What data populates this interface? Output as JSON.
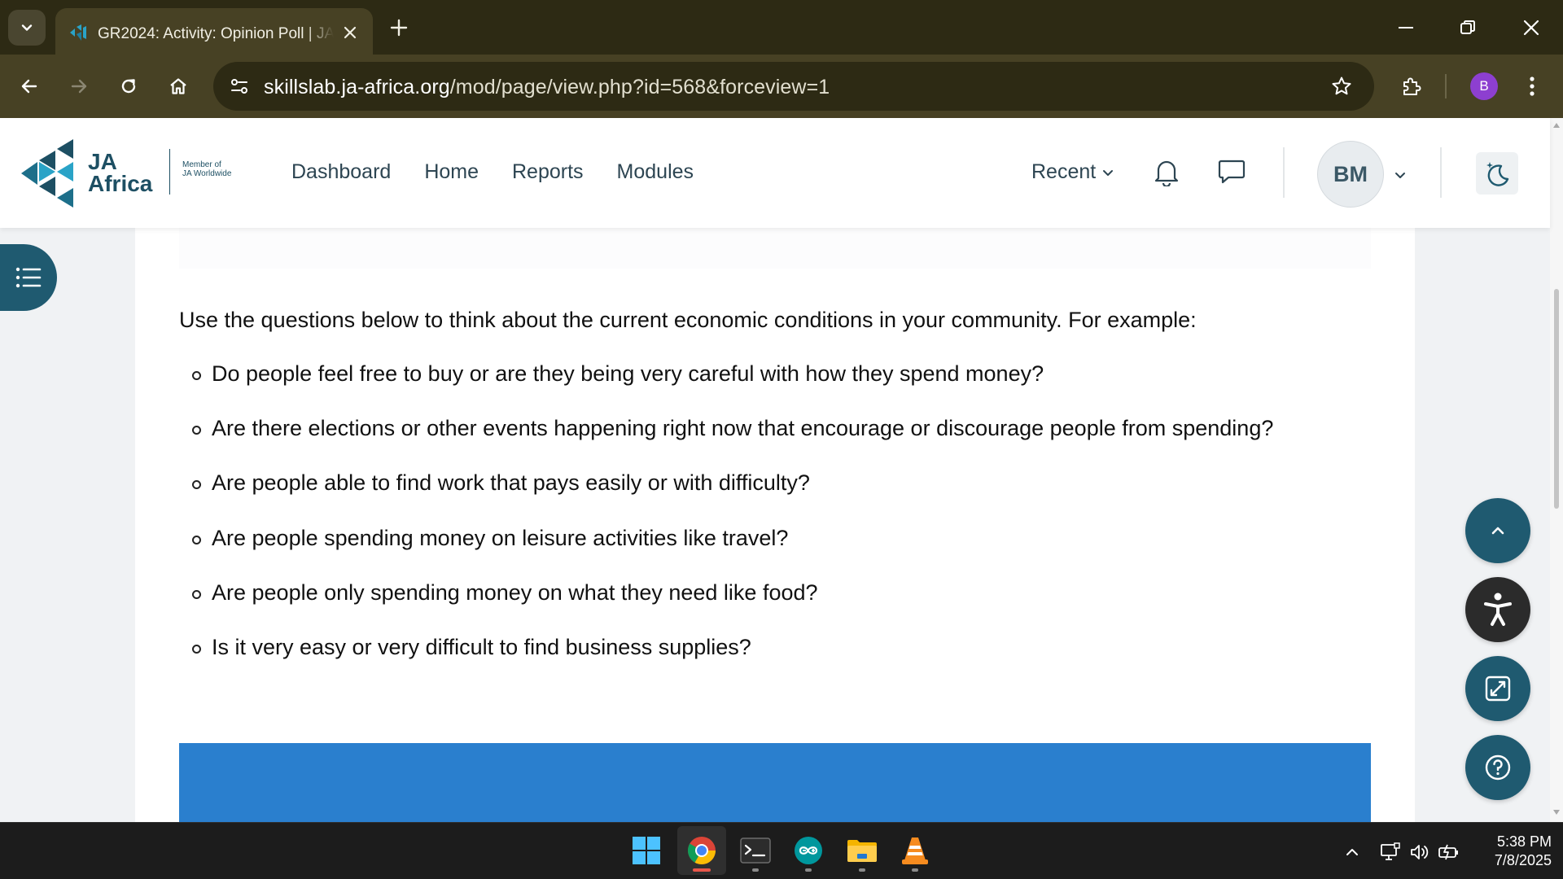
{
  "browser": {
    "tab_title": "GR2024: Activity: Opinion Poll | JA Africa",
    "url_host": "skillslab.ja-africa.org",
    "url_path": "/mod/page/view.php?id=568&forceview=1",
    "profile_initial": "B",
    "icons": [
      "tab-search-icon",
      "close-icon",
      "plus-icon",
      "minimize-icon",
      "restore-icon",
      "back-icon",
      "forward-icon",
      "reload-icon",
      "home-icon",
      "site-info-icon",
      "star-icon",
      "extensions-icon",
      "more-icon"
    ]
  },
  "header": {
    "logo_line1": "JA",
    "logo_line2": "Africa",
    "logo_member_line1": "Member of",
    "logo_member_line2": "JA Worldwide",
    "nav": [
      "Dashboard",
      "Home",
      "Reports",
      "Modules"
    ],
    "recent_label": "Recent",
    "avatar_initials": "BM",
    "brand_color": "#1d4f63"
  },
  "content": {
    "intro": "Use the questions below to think about the current economic conditions in your community. For example:",
    "questions": [
      "Do people feel free to buy or are they being very careful with how they spend money?",
      "Are there elections or other events happening right now that encourage or discourage people from spending?",
      "Are people able to find work that pays easily or with difficulty?",
      "Are people spending money on leisure activities like travel?",
      "Are people only spending money on what they need like food?",
      "Is it very easy or very difficult to find business supplies?"
    ],
    "banner_color": "#2a7fce"
  },
  "taskbar": {
    "time": "5:38 PM",
    "date": "7/8/2025",
    "apps": [
      "windows-start-icon",
      "chrome-icon",
      "terminal-icon",
      "arduino-icon",
      "file-explorer-icon",
      "vlc-icon"
    ]
  }
}
